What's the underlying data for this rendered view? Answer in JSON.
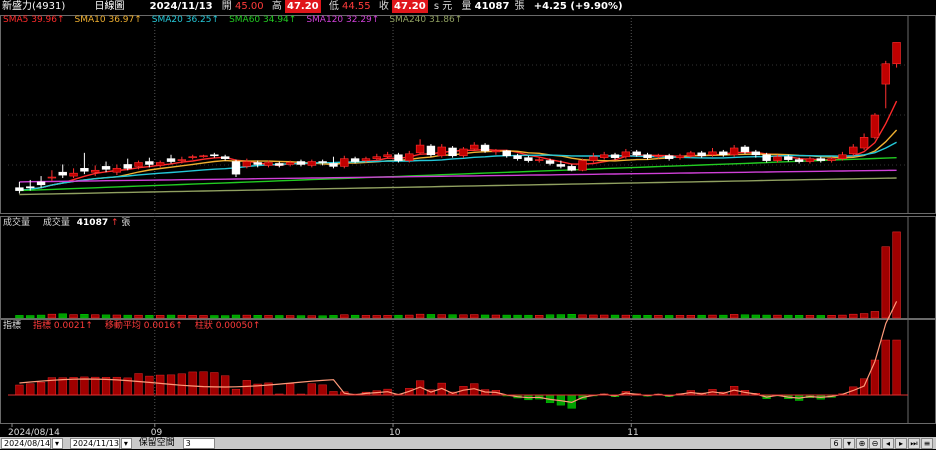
{
  "header": {
    "stock_name": "新盛力(4931)",
    "chart_type": "日線圖",
    "date": "2024/11/13",
    "open_label": "開",
    "open": "45.00",
    "high_label": "高",
    "high": "47.20",
    "low_label": "低",
    "low": "44.55",
    "close_label": "收",
    "close": "47.20",
    "unit_flag": "s 元",
    "volume_label": "量",
    "volume": "41087",
    "volume_unit": "張",
    "change": "+4.25 (+9.90%)"
  },
  "colors": {
    "up": "#b40000",
    "down": "#00a000",
    "sma5": "#ff2b2b",
    "sma10": "#f0b030",
    "sma20": "#24c8d8",
    "sma60": "#22cc22",
    "sma120": "#d040d8",
    "sma240": "#90a060"
  },
  "ma_legend": [
    {
      "label": "SMA5",
      "value": "39.96",
      "arrow": "↑",
      "color": "#ff2b2b"
    },
    {
      "label": "SMA10",
      "value": "36.97",
      "arrow": "↑",
      "color": "#f0b030"
    },
    {
      "label": "SMA20",
      "value": "36.25",
      "arrow": "↑",
      "color": "#24c8d8"
    },
    {
      "label": "SMA60",
      "value": "34.94",
      "arrow": "↑",
      "color": "#22cc22"
    },
    {
      "label": "SMA120",
      "value": "32.29",
      "arrow": "↑",
      "color": "#d040d8"
    },
    {
      "label": "SMA240",
      "value": "31.86",
      "arrow": "↑",
      "color": "#90a060"
    }
  ],
  "volume_panel": {
    "title": "成交量",
    "label": "成交量",
    "value": "41087",
    "arrow": "↑",
    "unit": "張"
  },
  "indicator_panel": {
    "title": "指標",
    "items": [
      {
        "label": "指標",
        "value": "0.0021",
        "arrow": "↑"
      },
      {
        "label": "移動平均",
        "value": "0.0016",
        "arrow": "↑"
      },
      {
        "label": "柱狀",
        "value": "0.00050",
        "arrow": "↑"
      }
    ]
  },
  "x_axis": {
    "ticks": [
      "2024/08/14",
      "09",
      "10",
      "11"
    ]
  },
  "bottom_bar": {
    "start_date": "2024/08/14",
    "end_date": "2024/11/13",
    "reserve_label": "保留空間",
    "reserve_value": "3",
    "count_value": "6"
  },
  "chart_data": {
    "type": "candlestick",
    "price_range": [
      30,
      49
    ],
    "candles": [
      [
        32.2,
        31.9,
        32.8,
        31.6
      ],
      [
        32.3,
        32.2,
        33.0,
        31.9
      ],
      [
        32.8,
        32.5,
        33.4,
        32.2
      ],
      [
        33.2,
        33.3,
        34.0,
        32.9
      ],
      [
        33.8,
        33.5,
        34.6,
        33.2
      ],
      [
        33.4,
        33.7,
        34.2,
        33.2
      ],
      [
        34.2,
        33.9,
        35.8,
        33.6
      ],
      [
        33.8,
        34.0,
        34.5,
        33.4
      ],
      [
        34.4,
        34.1,
        34.9,
        33.8
      ],
      [
        33.8,
        34.2,
        34.6,
        33.5
      ],
      [
        34.6,
        34.2,
        35.2,
        34.0
      ],
      [
        34.4,
        34.8,
        35.0,
        34.1
      ],
      [
        34.9,
        34.6,
        35.3,
        34.3
      ],
      [
        34.5,
        34.8,
        35.0,
        34.3
      ],
      [
        35.2,
        34.9,
        35.6,
        34.7
      ],
      [
        35.0,
        35.1,
        35.4,
        34.7
      ],
      [
        35.3,
        35.4,
        35.6,
        35.1
      ],
      [
        35.4,
        35.5,
        35.6,
        35.3
      ],
      [
        35.6,
        35.5,
        35.8,
        35.3
      ],
      [
        35.4,
        35.2,
        35.6,
        35.0
      ],
      [
        34.9,
        33.6,
        35.1,
        33.3
      ],
      [
        34.4,
        34.9,
        35.2,
        34.2
      ],
      [
        34.8,
        34.6,
        35.0,
        34.3
      ],
      [
        34.5,
        34.8,
        35.0,
        34.3
      ],
      [
        34.7,
        34.5,
        34.9,
        34.3
      ],
      [
        34.6,
        34.8,
        35.0,
        34.4
      ],
      [
        34.9,
        34.6,
        35.1,
        34.4
      ],
      [
        34.5,
        34.9,
        35.1,
        34.3
      ],
      [
        34.9,
        34.8,
        35.1,
        34.5
      ],
      [
        34.7,
        34.4,
        35.4,
        34.2
      ],
      [
        34.4,
        35.2,
        35.5,
        34.2
      ],
      [
        35.2,
        34.9,
        35.4,
        34.7
      ],
      [
        35.0,
        35.2,
        35.4,
        34.8
      ],
      [
        35.2,
        35.4,
        35.7,
        35.0
      ],
      [
        35.4,
        35.6,
        35.9,
        35.2
      ],
      [
        35.6,
        35.0,
        35.8,
        34.8
      ],
      [
        35.0,
        35.7,
        36.0,
        34.8
      ],
      [
        35.8,
        36.6,
        37.2,
        35.6
      ],
      [
        36.5,
        35.6,
        36.7,
        35.4
      ],
      [
        35.5,
        36.4,
        36.7,
        35.3
      ],
      [
        36.3,
        35.5,
        36.5,
        35.3
      ],
      [
        35.5,
        36.2,
        36.4,
        35.3
      ],
      [
        36.2,
        36.6,
        36.9,
        36.0
      ],
      [
        36.6,
        36.0,
        36.8,
        35.8
      ],
      [
        35.9,
        36.0,
        36.2,
        35.6
      ],
      [
        36.0,
        35.5,
        36.1,
        35.3
      ],
      [
        35.5,
        35.2,
        35.7,
        35.0
      ],
      [
        35.3,
        35.0,
        35.5,
        34.8
      ],
      [
        35.0,
        35.1,
        35.3,
        34.8
      ],
      [
        35.0,
        34.7,
        35.2,
        34.5
      ],
      [
        34.6,
        34.4,
        35.0,
        34.2
      ],
      [
        34.4,
        34.0,
        34.6,
        33.9
      ],
      [
        34.0,
        35.0,
        35.2,
        33.9
      ],
      [
        35.0,
        35.4,
        35.8,
        34.8
      ],
      [
        35.3,
        35.6,
        35.9,
        35.1
      ],
      [
        35.6,
        35.3,
        35.8,
        35.1
      ],
      [
        35.4,
        35.9,
        36.2,
        35.2
      ],
      [
        35.9,
        35.6,
        36.1,
        35.4
      ],
      [
        35.6,
        35.3,
        35.8,
        35.1
      ],
      [
        35.4,
        35.5,
        35.7,
        35.2
      ],
      [
        35.5,
        35.2,
        35.7,
        35.0
      ],
      [
        35.3,
        35.5,
        35.7,
        35.1
      ],
      [
        35.5,
        35.8,
        36.0,
        35.3
      ],
      [
        35.8,
        35.5,
        36.0,
        35.3
      ],
      [
        35.6,
        35.9,
        36.3,
        35.4
      ],
      [
        35.9,
        35.6,
        36.1,
        35.4
      ],
      [
        35.6,
        36.3,
        36.6,
        35.4
      ],
      [
        36.4,
        35.9,
        36.6,
        35.7
      ],
      [
        35.9,
        35.6,
        36.1,
        35.3
      ],
      [
        35.6,
        35.0,
        35.8,
        34.8
      ],
      [
        35.0,
        35.4,
        35.6,
        34.8
      ],
      [
        35.4,
        35.1,
        35.6,
        34.9
      ],
      [
        35.1,
        34.9,
        35.3,
        34.7
      ],
      [
        34.9,
        35.2,
        35.4,
        34.7
      ],
      [
        35.2,
        35.0,
        35.4,
        34.8
      ],
      [
        35.0,
        35.2,
        35.4,
        34.8
      ],
      [
        35.2,
        35.6,
        35.9,
        35.0
      ],
      [
        35.7,
        36.4,
        36.7,
        35.5
      ],
      [
        36.3,
        37.4,
        37.8,
        36.1
      ],
      [
        37.4,
        39.7,
        39.9,
        37.2
      ],
      [
        42.9,
        45.0,
        45.3,
        40.4
      ],
      [
        45.0,
        47.2,
        47.2,
        44.6
      ]
    ],
    "volumes": [
      420,
      380,
      520,
      900,
      1100,
      700,
      850,
      650,
      600,
      550,
      500,
      480,
      460,
      440,
      520,
      480,
      420,
      400,
      380,
      360,
      540,
      500,
      460,
      420,
      400,
      380,
      360,
      340,
      320,
      420,
      650,
      480,
      420,
      400,
      440,
      480,
      520,
      900,
      780,
      700,
      680,
      620,
      720,
      560,
      540,
      520,
      500,
      480,
      460,
      640,
      720,
      860,
      600,
      560,
      540,
      520,
      500,
      480,
      460,
      440,
      420,
      440,
      460,
      480,
      520,
      500,
      800,
      640,
      560,
      520,
      500,
      480,
      460,
      440,
      420,
      460,
      520,
      900,
      1200,
      2600,
      34000,
      41087
    ],
    "volume_range": [
      0,
      42000
    ]
  }
}
